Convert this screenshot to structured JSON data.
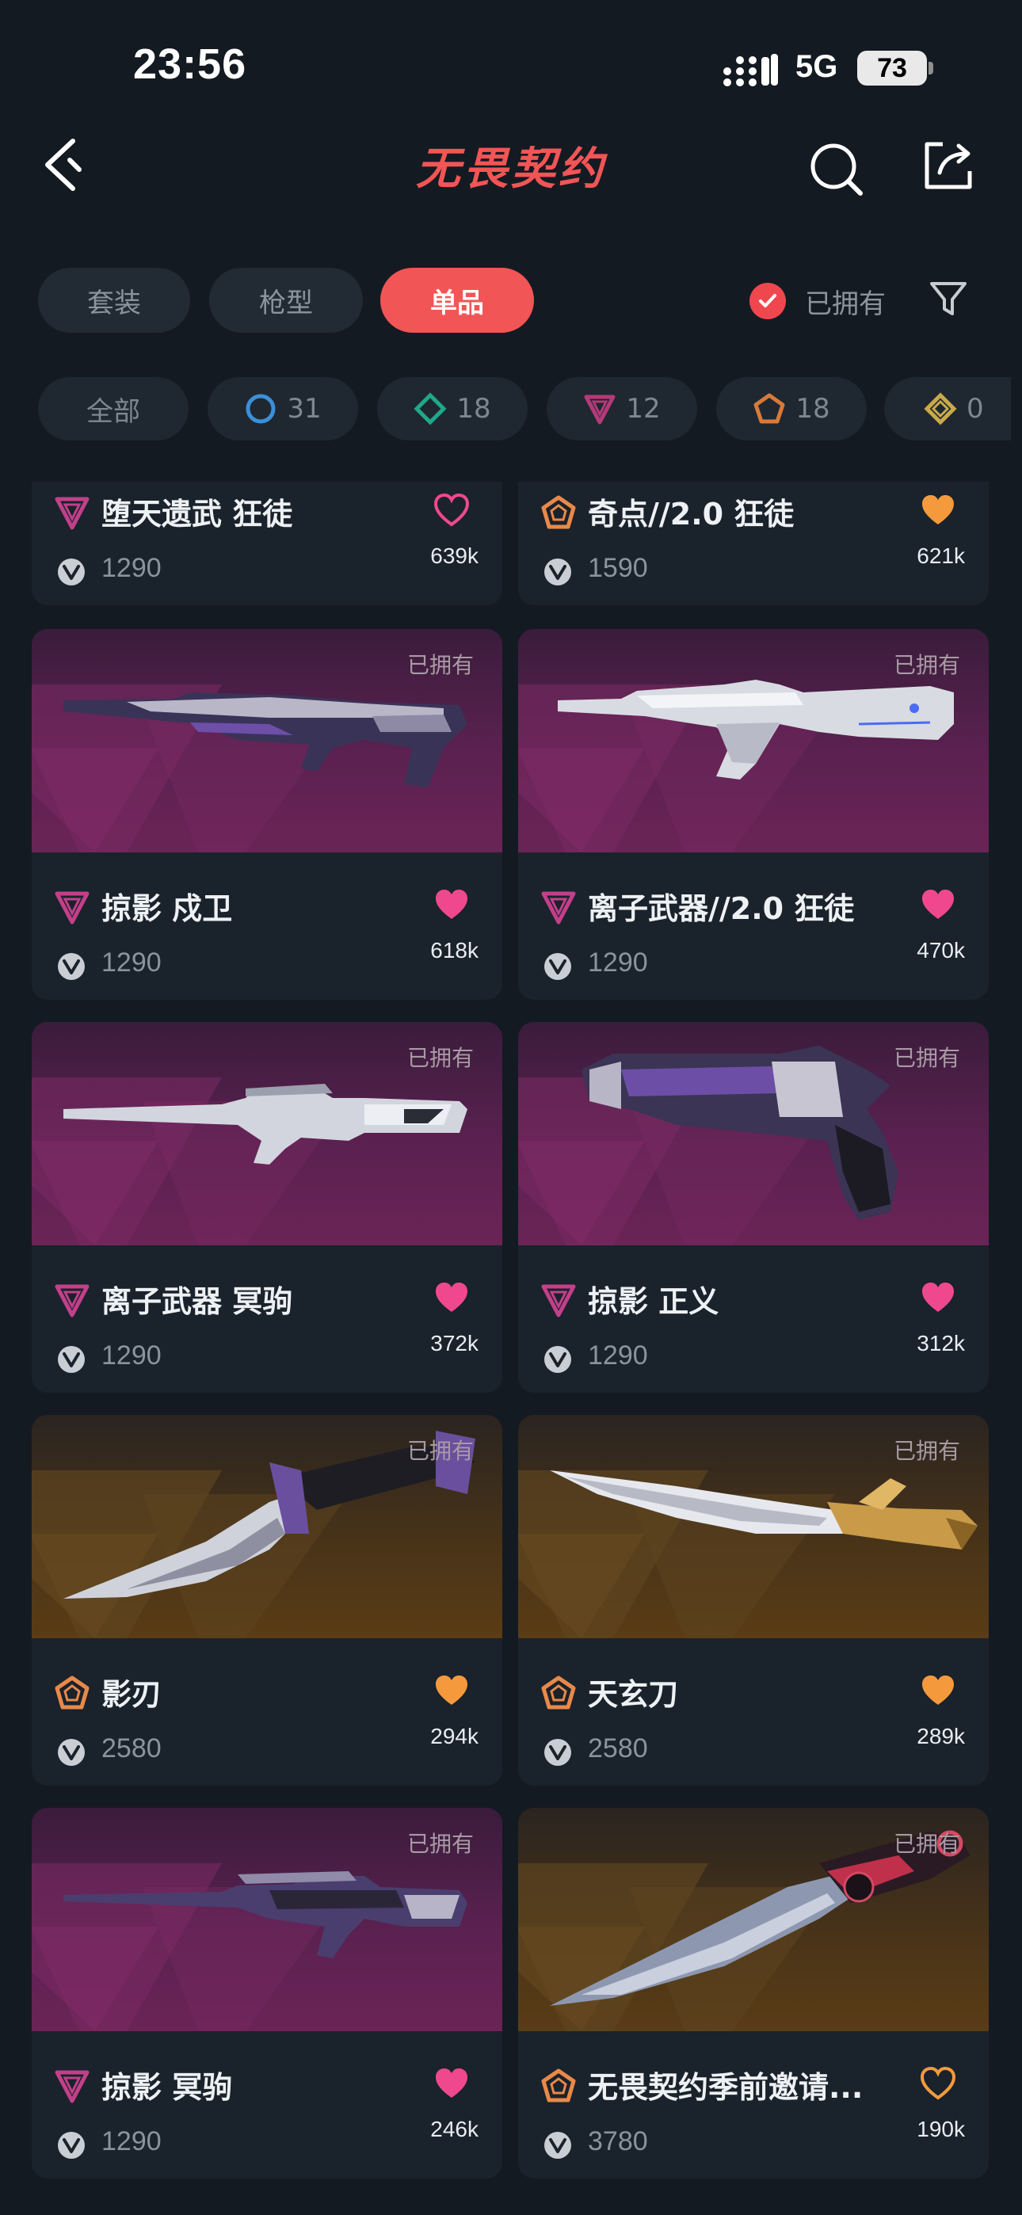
{
  "status": {
    "time": "23:56",
    "network": "5G",
    "battery": "73"
  },
  "header": {
    "title": "无畏契约"
  },
  "tabs": [
    {
      "label": "套装"
    },
    {
      "label": "枪型"
    },
    {
      "label": "单品"
    }
  ],
  "owned_filter": {
    "label": "已拥有"
  },
  "chips": [
    {
      "label": "全部"
    },
    {
      "count": "31",
      "color": "#3d8fd6"
    },
    {
      "count": "18",
      "color": "#1fa88a"
    },
    {
      "count": "12",
      "color": "#b43a78"
    },
    {
      "count": "18",
      "color": "#d97a3a"
    },
    {
      "count": "0",
      "color": "#c9a94a"
    }
  ],
  "owned_tag": "已拥有",
  "partial_items": [
    {
      "name": "堕天遗武 狂徒",
      "price": "1290",
      "likes": "639k",
      "tier": "premium",
      "favorited": false
    },
    {
      "name": "奇点//2.0 狂徒",
      "price": "1590",
      "likes": "621k",
      "tier": "exclusive",
      "favorited": true
    }
  ],
  "items": [
    {
      "name": "掠影 戍卫",
      "price": "1290",
      "likes": "618k",
      "tier": "premium",
      "bg": "purple",
      "weapon": "rifle-dark",
      "favorited": true
    },
    {
      "name": "离子武器//2.0 狂徒",
      "price": "1290",
      "likes": "470k",
      "tier": "premium",
      "bg": "purple",
      "weapon": "rifle-white",
      "favorited": true
    },
    {
      "name": "离子武器 冥驹",
      "price": "1290",
      "likes": "372k",
      "tier": "premium",
      "bg": "purple",
      "weapon": "sniper-white",
      "favorited": true
    },
    {
      "name": "掠影 正义",
      "price": "1290",
      "likes": "312k",
      "tier": "premium",
      "bg": "purple",
      "weapon": "revolver",
      "favorited": true
    },
    {
      "name": "影刃",
      "price": "2580",
      "likes": "294k",
      "tier": "exclusive",
      "bg": "gold",
      "weapon": "knife-dark",
      "favorited": true
    },
    {
      "name": "天玄刀",
      "price": "2580",
      "likes": "289k",
      "tier": "exclusive",
      "bg": "gold",
      "weapon": "knife-gold",
      "favorited": true
    },
    {
      "name": "掠影 冥驹",
      "price": "1290",
      "likes": "246k",
      "tier": "premium",
      "bg": "purple",
      "weapon": "sniper-dark",
      "favorited": true
    },
    {
      "name": "无畏契约季前邀请...",
      "price": "3780",
      "likes": "190k",
      "tier": "exclusive",
      "bg": "gold",
      "weapon": "knife-red",
      "favorited": false
    }
  ],
  "colors": {
    "accent": "#f25555",
    "premium": "#c2408a",
    "exclusive": "#e8894a",
    "heart_premium": "#f0488e",
    "heart_exclusive": "#f59a3c"
  }
}
